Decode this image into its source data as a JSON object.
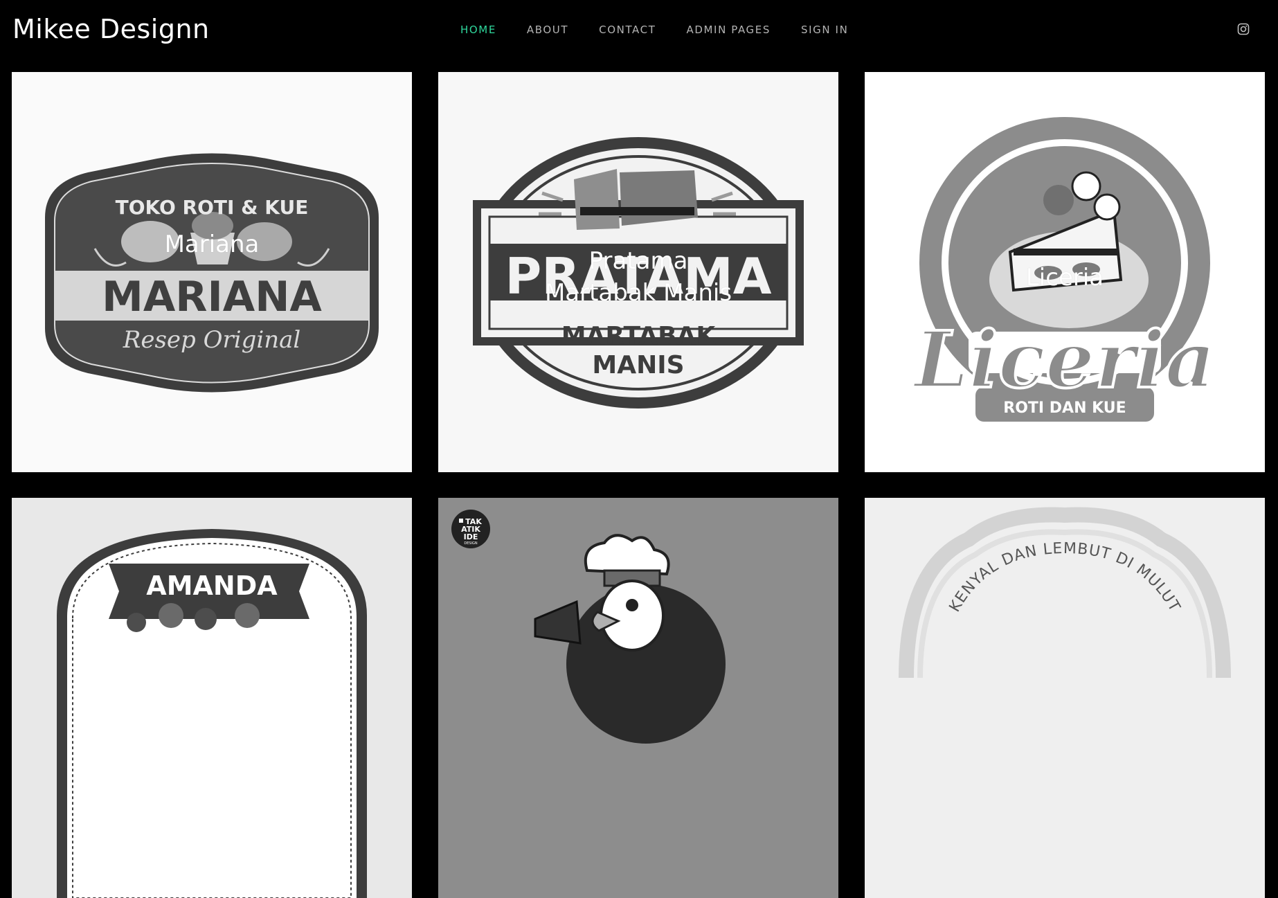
{
  "header": {
    "brand": "Mikee Designn",
    "nav": [
      {
        "label": "HOME",
        "active": true
      },
      {
        "label": "ABOUT",
        "active": false
      },
      {
        "label": "CONTACT",
        "active": false
      },
      {
        "label": "ADMIN PAGES",
        "active": false
      },
      {
        "label": "SIGN IN",
        "active": false
      }
    ],
    "social_icon": "instagram-icon"
  },
  "colors": {
    "background": "#000000",
    "nav_active": "#2fd79c",
    "nav_inactive": "#b3b3b3"
  },
  "gallery": [
    {
      "caption": "Mariana",
      "logo": {
        "top": "TOKO ROTI & KUE",
        "name": "MARIANA",
        "bottom": "Resep Original"
      }
    },
    {
      "caption_line1": "Pratama",
      "caption_line2": "Martabak Manis",
      "logo": {
        "name": "PRATAMA",
        "line1": "MARTABAK",
        "line2": "MANIS"
      }
    },
    {
      "caption": "Liceria",
      "logo": {
        "name": "Liceria",
        "tagline": "ROTI DAN KUE"
      }
    },
    {
      "logo": {
        "name": "AMANDA"
      }
    },
    {
      "logo": {
        "badge_line1": "TAK",
        "badge_line2": "ATIK",
        "badge_line3": "IDE",
        "badge_line4": "DESIGN"
      }
    },
    {
      "logo": {
        "arc_text": "KENYAL DAN LEMBUT DI MULUT"
      }
    }
  ]
}
